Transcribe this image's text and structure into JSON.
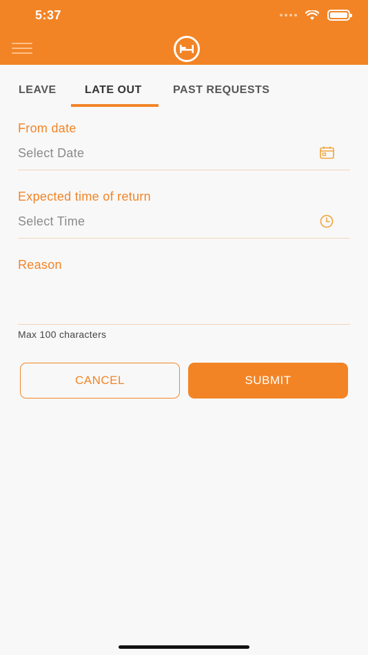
{
  "status_bar": {
    "time": "5:37"
  },
  "header": {
    "menu_icon": "hamburger-icon",
    "logo_icon": "bed-icon"
  },
  "tabs": [
    {
      "label": "LEAVE",
      "active": false
    },
    {
      "label": "LATE OUT",
      "active": true
    },
    {
      "label": "PAST REQUESTS",
      "active": false
    }
  ],
  "form": {
    "from_date": {
      "label": "From date",
      "placeholder": "Select Date",
      "icon": "calendar-icon"
    },
    "return_time": {
      "label": "Expected time of return",
      "placeholder": "Select Time",
      "icon": "clock-icon"
    },
    "reason": {
      "label": "Reason",
      "value": "",
      "hint": "Max 100 characters"
    }
  },
  "actions": {
    "cancel_label": "CANCEL",
    "submit_label": "SUBMIT"
  },
  "colors": {
    "accent": "#f28426",
    "background": "#f8f8f8",
    "placeholder": "#8a8a8a"
  }
}
